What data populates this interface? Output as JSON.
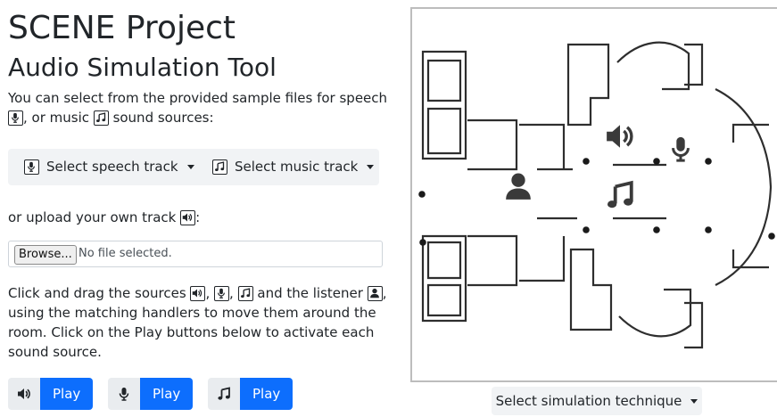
{
  "header": {
    "title": "SCENE Project",
    "subtitle": "Audio Simulation Tool"
  },
  "intro": {
    "part1": "You can select from the provided sample files for speech",
    "part2": ", or music",
    "part3": "sound sources:"
  },
  "toolbar": {
    "speech_label": "Select speech track",
    "music_label": "Select music track"
  },
  "upload": {
    "prompt": "or upload your own track",
    "prompt_suffix": ":",
    "browse_label": "Browse...",
    "status": "No file selected."
  },
  "instructions": {
    "t1": "Click and drag the sources",
    "t2": ",",
    "t3": ",",
    "t4": "and the listener",
    "t5": ",",
    "t6": "using the matching handlers to move them around the room. Click on the Play buttons below to activate each sound source."
  },
  "play_buttons": [
    {
      "icon": "speaker-icon",
      "label": "Play"
    },
    {
      "icon": "microphone-icon",
      "label": "Play"
    },
    {
      "icon": "music-note-icon",
      "label": "Play"
    }
  ],
  "simulation": {
    "label": "Select simulation technique"
  },
  "colors": {
    "primary": "#0d6efd",
    "toolbar_bg": "#f1f3f5",
    "icon_dark": "#3a3a3a"
  }
}
